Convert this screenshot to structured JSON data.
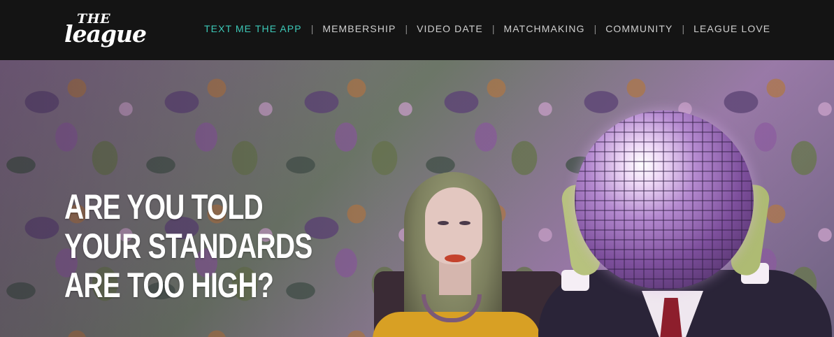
{
  "brand": {
    "logo_the": "THE",
    "logo_league": "league"
  },
  "nav": {
    "items": [
      {
        "label": "TEXT ME THE APP",
        "active": true
      },
      {
        "label": "MEMBERSHIP",
        "active": false
      },
      {
        "label": "VIDEO DATE",
        "active": false
      },
      {
        "label": "MATCHMAKING",
        "active": false
      },
      {
        "label": "COMMUNITY",
        "active": false
      },
      {
        "label": "LEAGUE LOVE",
        "active": false
      }
    ],
    "separator": "|"
  },
  "hero": {
    "headline_lines": [
      "ARE YOU TOLD",
      "YOUR STANDARDS",
      "ARE TOO HIGH?"
    ]
  },
  "colors": {
    "header_bg": "#141414",
    "nav_active": "#3cc8b7",
    "nav_text": "#cfcfcf",
    "headline": "#ffffff"
  },
  "icons": {
    "logo": "the-league-logo"
  }
}
